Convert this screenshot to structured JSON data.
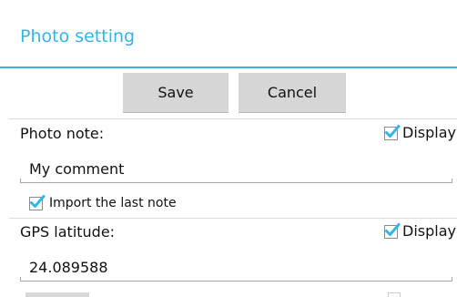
{
  "dialog": {
    "title": "Photo setting",
    "accent_color": "#33b5e5"
  },
  "buttons": {
    "save_label": "Save",
    "cancel_label": "Cancel"
  },
  "photo_note": {
    "label": "Photo note:",
    "display_label": "Display",
    "display_checked": true,
    "value": "My comment",
    "import_label": "Import the last note",
    "import_checked": true
  },
  "gps_latitude": {
    "label": "GPS latitude:",
    "display_label": "Display",
    "display_checked": true,
    "value": "24.089588"
  },
  "icons": {
    "checkmark": "checkmark-icon"
  }
}
